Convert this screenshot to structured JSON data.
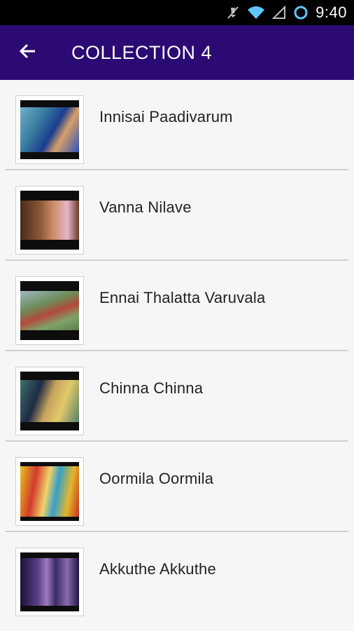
{
  "status_bar": {
    "time": "9:40",
    "icons": [
      "mute-icon",
      "wifi-icon",
      "signal-icon",
      "sync-icon"
    ]
  },
  "app_bar": {
    "title": "COLLECTION 4",
    "back_icon": "arrow-back-icon",
    "color": "#2c0a73"
  },
  "songs": [
    {
      "title": "Innisai Paadivarum"
    },
    {
      "title": "Vanna Nilave"
    },
    {
      "title": "Ennai Thalatta Varuvala"
    },
    {
      "title": "Chinna Chinna"
    },
    {
      "title": "Oormila Oormila"
    },
    {
      "title": "Akkuthe Akkuthe"
    }
  ]
}
